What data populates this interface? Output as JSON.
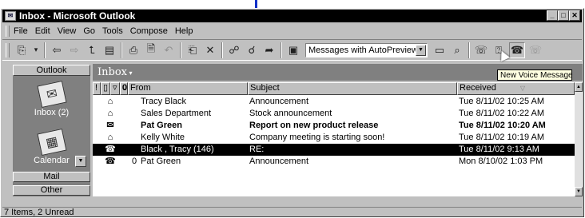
{
  "window": {
    "title": "Inbox - Microsoft Outlook",
    "controls": [
      "minimize",
      "maximize",
      "close"
    ]
  },
  "menubar": {
    "items": [
      {
        "label": "File",
        "accel": "F"
      },
      {
        "label": "Edit",
        "accel": "E"
      },
      {
        "label": "View",
        "accel": "V"
      },
      {
        "label": "Go",
        "accel": "G"
      },
      {
        "label": "Tools",
        "accel": "T"
      },
      {
        "label": "Compose",
        "accel": "m"
      },
      {
        "label": "Help",
        "accel": "H"
      }
    ]
  },
  "toolbar": {
    "view_selector": "Messages with AutoPreview",
    "icons": [
      "new-item-icon",
      "back-icon",
      "forward-icon",
      "up-one-level-icon",
      "folder-list-icon",
      "print-icon",
      "print-preview-icon",
      "undo-icon",
      "move-to-folder-icon",
      "delete-icon",
      "reply-icon",
      "reply-all-icon",
      "forward-message-icon",
      "address-book-icon",
      "preview-pane-icon",
      "find-icon",
      "organize-icon",
      "help-icon",
      "voice-message-icon",
      "voice-reply-icon"
    ]
  },
  "tooltip": {
    "text": "New Voice Message"
  },
  "outlook_bar": {
    "header": "Outlook",
    "items": [
      {
        "label": "Inbox (2)",
        "icon": "inbox-icon"
      },
      {
        "label": "Calendar",
        "icon": "calendar-icon"
      }
    ],
    "groups": [
      "Mail",
      "Other"
    ]
  },
  "folder_banner": {
    "title": "Inbox"
  },
  "message_list": {
    "columns": {
      "importance": "!",
      "icon": "",
      "flag": "",
      "attachment": "",
      "from": "From",
      "subject": "Subject",
      "received": "Received"
    },
    "rows": [
      {
        "icon": "read-envelope-icon",
        "attach": "",
        "from": "Tracy Black",
        "subject": "Announcement",
        "received": "Tue 8/11/02 10:25 AM",
        "unread": false,
        "selected": false
      },
      {
        "icon": "read-envelope-icon",
        "attach": "",
        "from": "Sales Department",
        "subject": "Stock announcement",
        "received": "Tue 8/11/02 10:22 AM",
        "unread": false,
        "selected": false
      },
      {
        "icon": "unread-envelope-icon",
        "attach": "",
        "from": "Pat Green",
        "subject": "Report on new product release",
        "received": "Tue 8/11/02 10:20 AM",
        "unread": true,
        "selected": false
      },
      {
        "icon": "read-envelope-icon",
        "attach": "",
        "from": "Kelly White",
        "subject": "Company meeting is starting soon!",
        "received": "Tue 8/11/02 10:19 AM",
        "unread": false,
        "selected": false
      },
      {
        "icon": "voice-message-icon",
        "attach": "",
        "from": "Black , Tracy  (146)",
        "subject": "RE:",
        "received": "Tue 8/11/02 9:13 AM",
        "unread": false,
        "selected": true
      },
      {
        "icon": "voice-message-icon",
        "attach": "0",
        "from": "Pat Green",
        "subject": "Announcement",
        "received": "Mon 8/10/02 1:03 PM",
        "unread": false,
        "selected": false
      }
    ]
  },
  "status_bar": {
    "text": "7 Items, 2 Unread"
  }
}
